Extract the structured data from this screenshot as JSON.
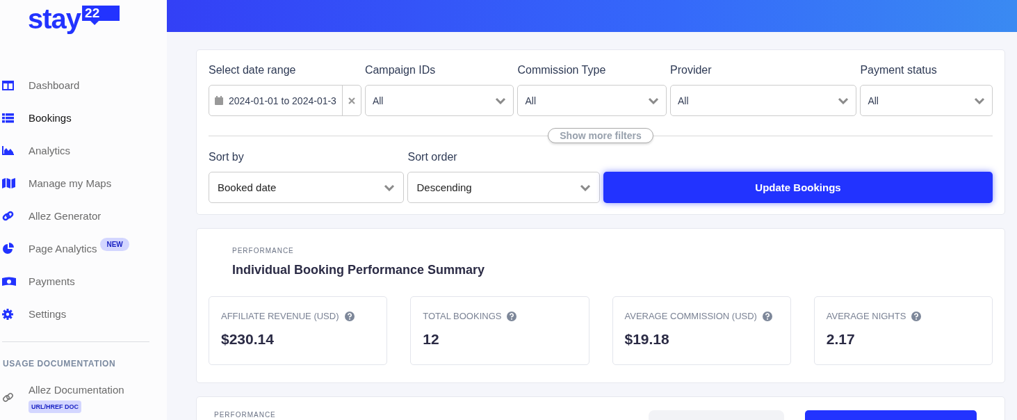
{
  "brand": {
    "word": "stay",
    "badge": "22"
  },
  "sidebar": {
    "items": [
      {
        "label": "Dashboard",
        "kind": "dashboard",
        "selected": false
      },
      {
        "label": "Bookings",
        "kind": "list",
        "selected": true
      },
      {
        "label": "Analytics",
        "kind": "chart",
        "selected": false
      },
      {
        "label": "Manage my Maps",
        "kind": "map",
        "selected": false
      },
      {
        "label": "Allez Generator",
        "kind": "link",
        "selected": false
      },
      {
        "label": "Page Analytics",
        "kind": "pie",
        "selected": false,
        "badge": "NEW"
      },
      {
        "label": "Payments",
        "kind": "money",
        "selected": false
      },
      {
        "label": "Settings",
        "kind": "gear",
        "selected": false
      }
    ],
    "section_title": "USAGE DOCUMENTATION",
    "doc_items": [
      {
        "label": "Allez Documentation",
        "badge": "URL/HREF DOC"
      }
    ]
  },
  "filters": [
    {
      "label": "Select date range",
      "value": "2024-01-01 to 2024-01-3",
      "kind": "date"
    },
    {
      "label": "Campaign IDs",
      "value": "All",
      "kind": "select"
    },
    {
      "label": "Commission Type",
      "value": "All",
      "kind": "select"
    },
    {
      "label": "Provider",
      "value": "All",
      "kind": "select"
    },
    {
      "label": "Payment status",
      "value": "All",
      "kind": "select"
    }
  ],
  "show_more_button": "Show more filters",
  "sort": [
    {
      "label": "Sort by",
      "value": "Booked date"
    },
    {
      "label": "Sort order",
      "value": "Descending"
    }
  ],
  "update_button": "Update Bookings",
  "performance": {
    "eyebrow": "PERFORMANCE",
    "title": "Individual Booking Performance Summary",
    "stats": [
      {
        "label": "AFFILIATE REVENUE (USD)",
        "value": "$230.14"
      },
      {
        "label": "TOTAL BOOKINGS",
        "value": "12"
      },
      {
        "label": "AVERAGE COMMISSION (USD)",
        "value": "$19.18"
      },
      {
        "label": "AVERAGE NIGHTS",
        "value": "2.17"
      }
    ]
  },
  "next_section": {
    "eyebrow": "PERFORMANCE"
  }
}
